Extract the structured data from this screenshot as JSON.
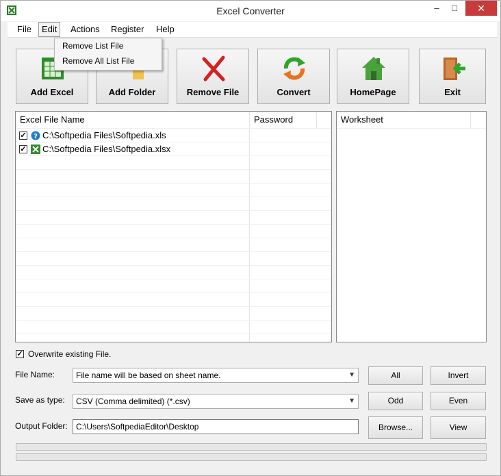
{
  "window": {
    "title": "Excel Converter",
    "minimize": "–",
    "maximize": "□",
    "close": "✕"
  },
  "menu": [
    {
      "label": "File"
    },
    {
      "label": "Edit"
    },
    {
      "label": "Actions"
    },
    {
      "label": "Register"
    },
    {
      "label": "Help"
    }
  ],
  "edit_dropdown": [
    "Remove List File",
    "Remove All List File"
  ],
  "toolbar": [
    {
      "label": "Add Excel",
      "icon": "add-excel-icon"
    },
    {
      "label": "Add Folder",
      "icon": "folder-icon"
    },
    {
      "label": "Remove File",
      "icon": "remove-x-icon"
    },
    {
      "label": "Convert",
      "icon": "convert-arrows-icon"
    },
    {
      "label": "HomePage",
      "icon": "home-icon"
    },
    {
      "label": "Exit",
      "icon": "exit-door-icon"
    }
  ],
  "file_list": {
    "columns": [
      "Excel File Name",
      "Password"
    ],
    "rows": [
      {
        "checked": true,
        "icon": "unknown-file-icon",
        "name": "C:\\Softpedia Files\\Softpedia.xls",
        "password": ""
      },
      {
        "checked": true,
        "icon": "excel-file-icon",
        "name": "C:\\Softpedia Files\\Softpedia.xlsx",
        "password": ""
      }
    ]
  },
  "worksheet_list": {
    "columns": [
      "Worksheet"
    ]
  },
  "options": {
    "overwrite_label": "Overwrite existing File.",
    "overwrite_checked": true,
    "file_name_label": "File Name:",
    "file_name_value": "File name will be based on sheet name.",
    "save_as_label": "Save as type:",
    "save_as_value": "CSV (Comma delimited) (*.csv)",
    "output_folder_label": "Output Folder:",
    "output_folder_value": "C:\\Users\\SoftpediaEditor\\Desktop"
  },
  "buttons": {
    "all": "All",
    "invert": "Invert",
    "odd": "Odd",
    "even": "Even",
    "browse": "Browse...",
    "view": "View"
  },
  "colors": {
    "close_button": "#c73b3b",
    "remove_x": "#d42020",
    "convert_green": "#2ea52e",
    "convert_orange": "#e8731c",
    "home_green": "#4aa23c",
    "exit_door": "#b5652c"
  }
}
